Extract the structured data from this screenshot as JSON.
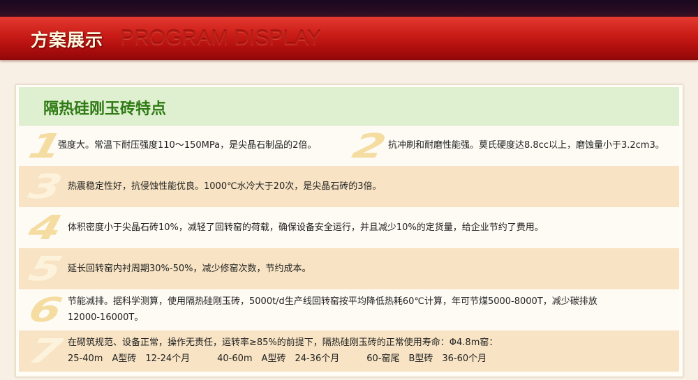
{
  "header": {
    "title": "方案展示",
    "subtitle": "PROGRAM DISPLAY"
  },
  "card": {
    "title": "隔热硅刚玉砖特点"
  },
  "features": [
    {
      "num": "1",
      "text": "强度大。常温下耐压强度110～150MPa，是尖晶石制品的2倍。"
    },
    {
      "num": "2",
      "text": "抗冲刷和耐磨性能强。莫氏硬度达8.8cc以上，磨蚀量小于3.2cm3。"
    },
    {
      "num": "3",
      "text": "热震稳定性好，抗侵蚀性能优良。1000℃水冷大于20次，是尖晶石砖的3倍。"
    },
    {
      "num": "4",
      "text": "体积密度小于尖晶石砖10%，减轻了回转窑的荷载，确保设备安全运行，并且减少10%的定货量，给企业节约了费用。"
    },
    {
      "num": "5",
      "text": "延长回转窑内衬周期30%-50%，减少修窑次数，节约成本。"
    },
    {
      "num": "6",
      "line1": "节能减排。据科学测算，使用隔热硅刚玉砖，5000t/d生产线回转窑按平均降低热耗60℃计算，年可节煤5000-8000T，减少碳排放",
      "line2": "12000-16000T。"
    },
    {
      "num": "7",
      "line1": "在砌筑规范、设备正常，操作无责任，运转率≥85%的前提下，隔热硅刚玉砖的正常使用寿命：Φ4.8m窑：",
      "line2": "25-40m　A型砖　12-24个月　　　40-60m　A型砖　24-36个月　　　60-窑尾　B型砖　36-60个月"
    }
  ],
  "colors": {
    "banner": "#c81a16",
    "title_green": "#2e7a14",
    "row_alt": "#f8e4c4",
    "number": "#f5dca0"
  }
}
